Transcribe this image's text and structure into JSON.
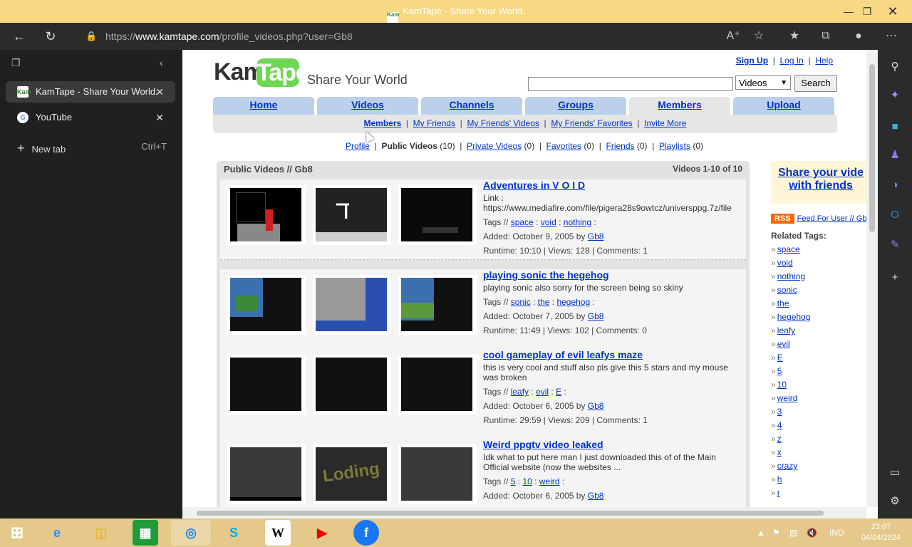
{
  "window": {
    "title": "KamTape - Share Your World.",
    "favicon_text": "Kam"
  },
  "address": {
    "prefix": "https://",
    "host": "www.kamtape.com",
    "path": "/profile_videos.php?user=Gb8"
  },
  "sidebar": {
    "tabs": [
      {
        "label": "KamTape - Share Your World.",
        "fav": "Kam"
      },
      {
        "label": "YouTube",
        "fav": "G"
      }
    ],
    "new_tab_label": "New tab",
    "new_tab_shortcut": "Ctrl+T"
  },
  "site": {
    "logo_left": "Kam",
    "logo_right": "Tape",
    "slogan": "Share Your World",
    "top_links": [
      "Sign Up",
      "Log In",
      "Help"
    ],
    "search_select": "Videos",
    "search_button": "Search",
    "nav": [
      "Home",
      "Videos",
      "Channels",
      "Groups",
      "Members",
      "Upload"
    ],
    "subnav": [
      "Members",
      "My Friends",
      "My Friends' Videos",
      "My Friends' Favorites",
      "Invite More"
    ],
    "profile_links": [
      {
        "label": "Profile",
        "count": ""
      },
      {
        "label": "Public Videos",
        "count": "(10)"
      },
      {
        "label": "Private Videos",
        "count": "(0)"
      },
      {
        "label": "Favorites",
        "count": "(0)"
      },
      {
        "label": "Friends",
        "count": "(0)"
      },
      {
        "label": "Playlists",
        "count": "(0)"
      }
    ]
  },
  "main": {
    "header": "Public Videos // Gb8",
    "range": "Videos 1-10 of 10",
    "videos": [
      {
        "title": "Adventures in V O I D",
        "desc": "Link : https://www.mediafire.com/file/pigera28s9owtcz/universppg.7z/file",
        "tags": [
          "space",
          "void",
          "nothing"
        ],
        "added": "Added: October 9, 2005 by",
        "user": "Gb8",
        "runtime": "Runtime: 10:10 | Views: 128 | Comments: 1"
      },
      {
        "title": "playing sonic the hegehog",
        "desc": "playing sonic also sorry for the screen being so skiny",
        "tags": [
          "sonic",
          "the",
          "hegehog"
        ],
        "added": "Added: October 7, 2005 by",
        "user": "Gb8",
        "runtime": "Runtime: 11:49 | Views: 102 | Comments: 0"
      },
      {
        "title": "cool gameplay of evil leafys maze",
        "desc": "this is very cool and stuff also pls give this 5 stars and my mouse was broken",
        "tags": [
          "leafy",
          "evil",
          "E"
        ],
        "added": "Added: October 6, 2005 by",
        "user": "Gb8",
        "runtime": "Runtime: 29:59 | Views: 209 | Comments: 1"
      },
      {
        "title": "Weird ppgtv video leaked",
        "desc": "Idk what to put here man I just downloaded this of of the Main Official website (now the websites ...",
        "tags": [
          "5",
          "10",
          "weird"
        ],
        "added": "Added: October 6, 2005 by",
        "user": "Gb8",
        "runtime": ""
      }
    ],
    "tags_label": "Tags //",
    "thumb_text": "Loding"
  },
  "side": {
    "share_line1": "Share your vide",
    "share_line2": "with friends",
    "rss": "RSS",
    "feed": "Feed For User // Gb",
    "related_title": "Related Tags:",
    "related": [
      "space",
      "void",
      "nothing",
      "sonic",
      "the",
      "hegehog",
      "leafy",
      "evil",
      "E",
      "5",
      "10",
      "weird",
      "3",
      "4",
      "z",
      "x",
      "crazy",
      "h",
      "r"
    ]
  },
  "taskbar": {
    "lang": "IND",
    "time": "23:07",
    "date": "04/04/2024"
  }
}
